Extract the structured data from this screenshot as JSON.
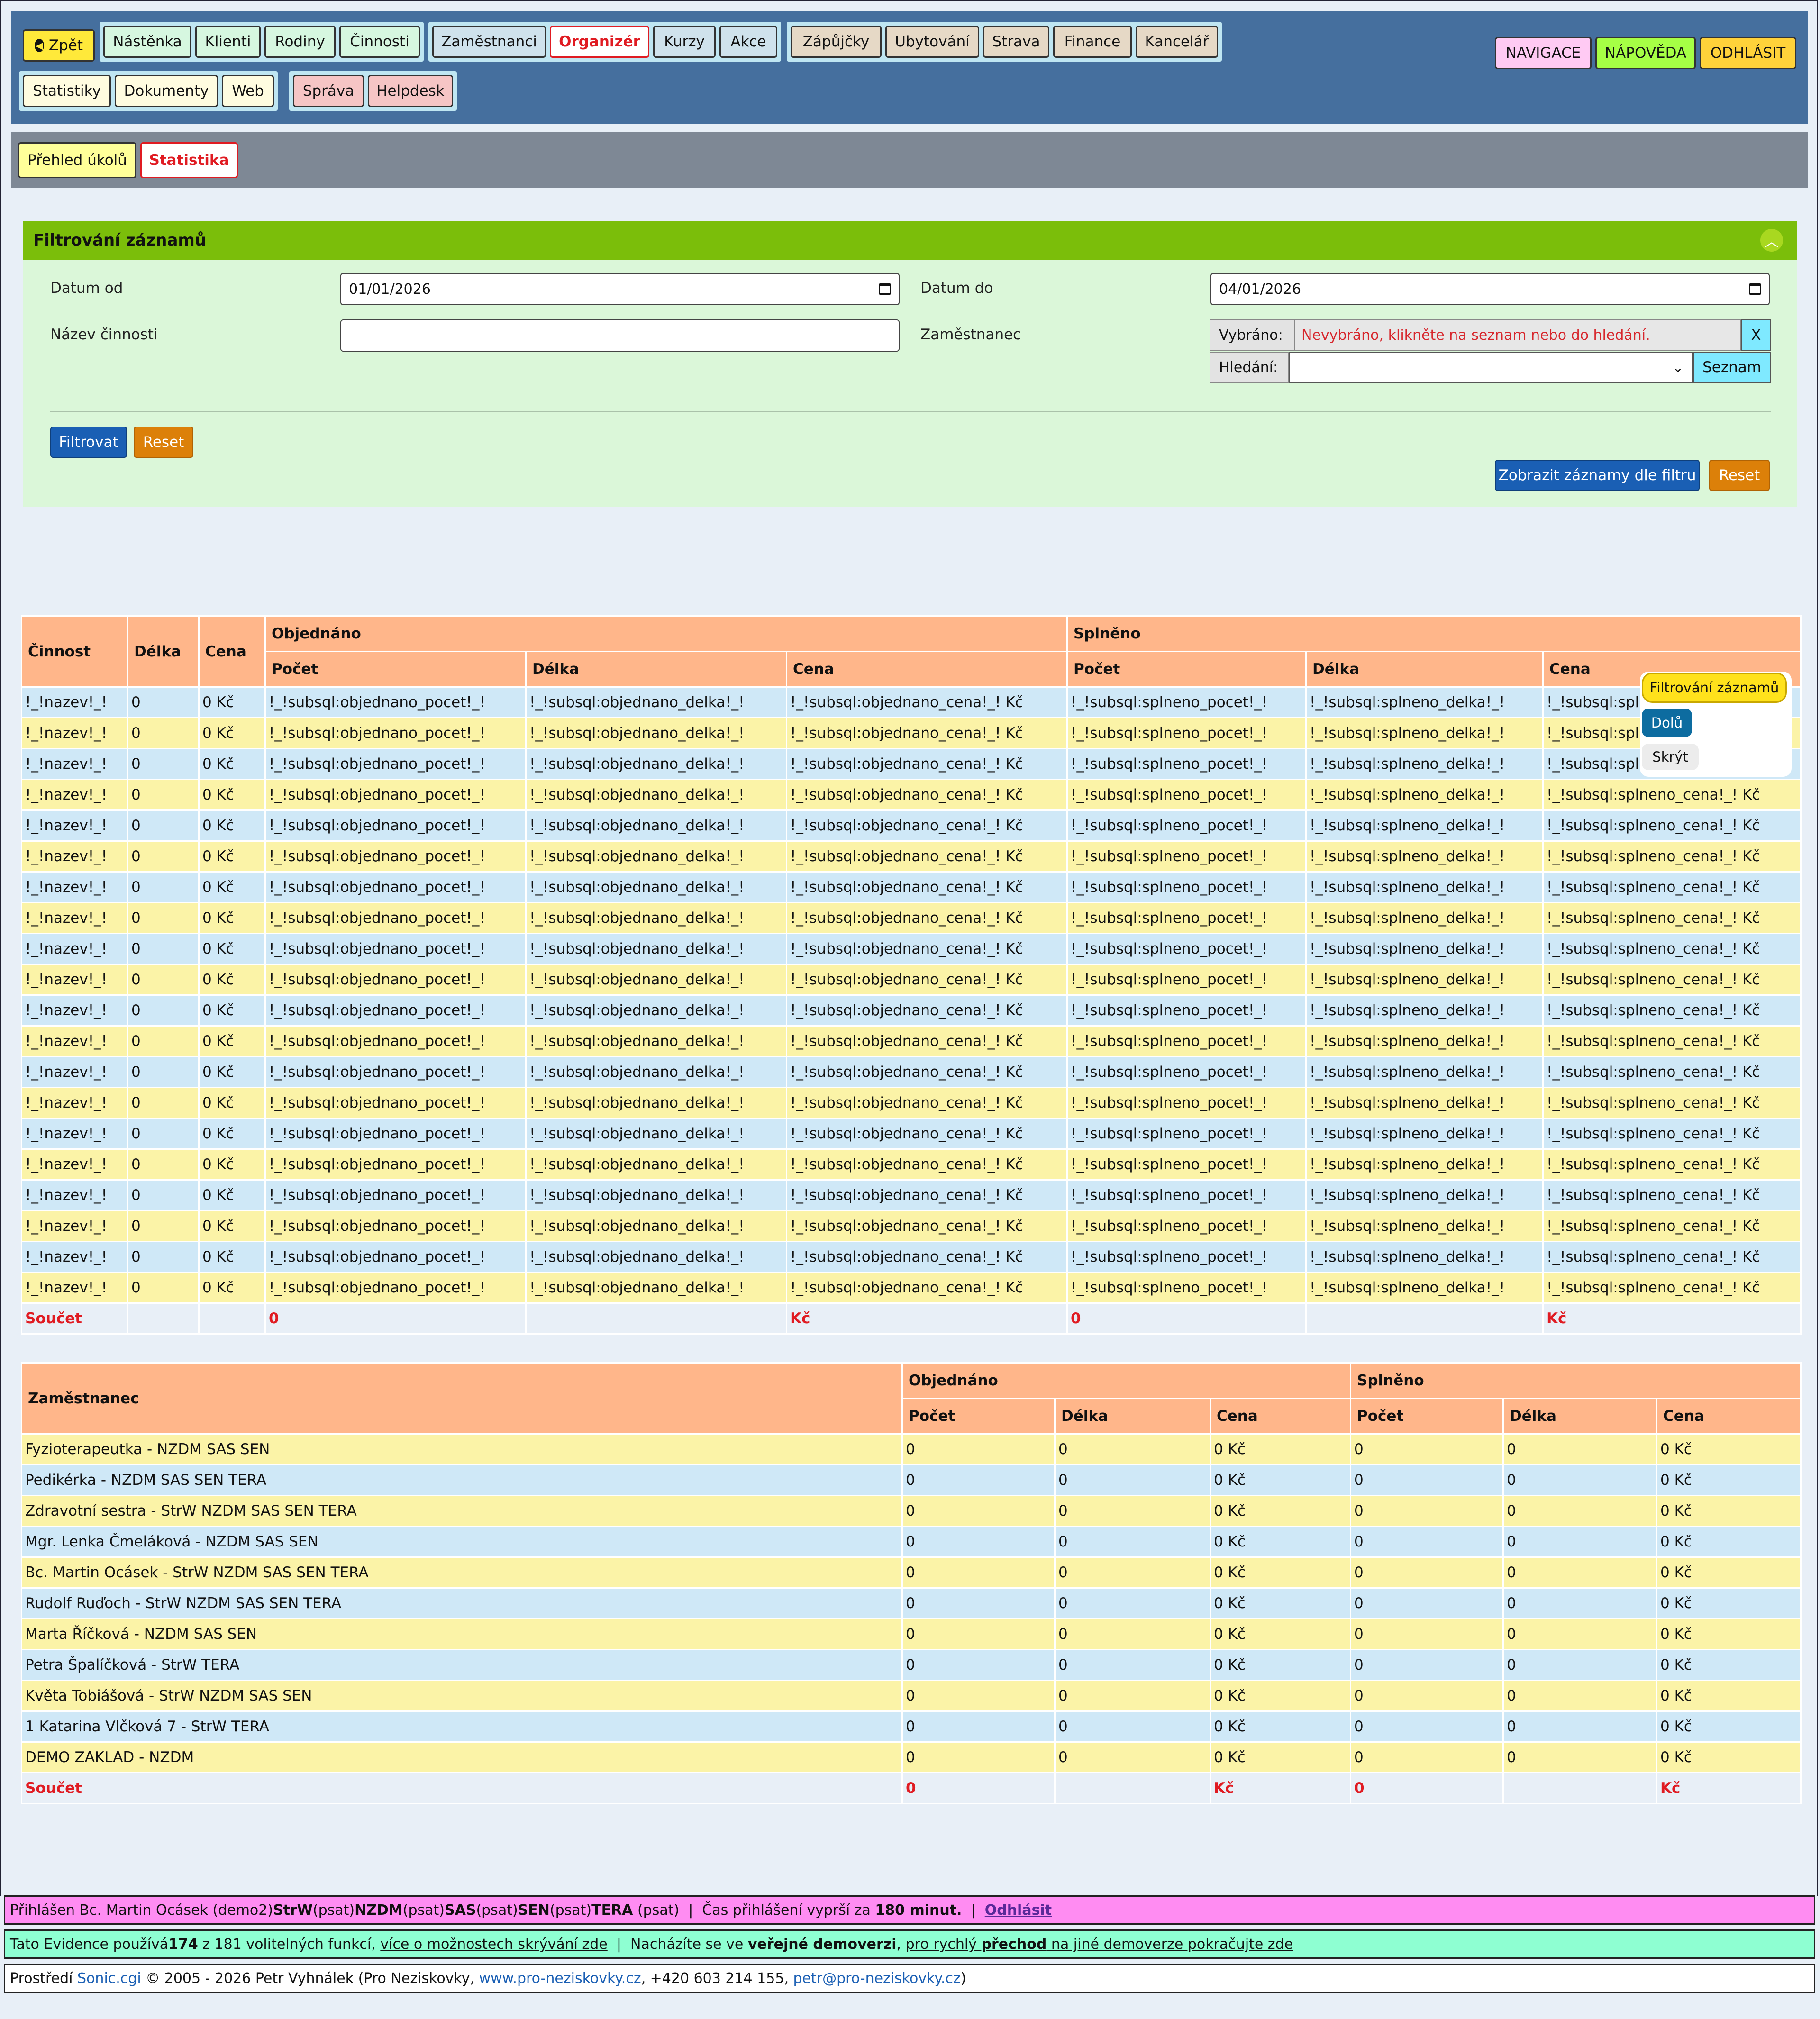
{
  "nav": {
    "back": "Zpět",
    "row1_group1": [
      "Nástěnka",
      "Klienti",
      "Rodiny",
      "Činnosti"
    ],
    "row1_group2": [
      "Zaměstnanci",
      "Organizér",
      "Kurzy",
      "Akce"
    ],
    "row1_group3": [
      "Zápůjčky",
      "Ubytování",
      "Strava",
      "Finance",
      "Kancelář"
    ],
    "row2_group1": [
      "Statistiky",
      "Dokumenty",
      "Web"
    ],
    "row2_group2": [
      "Správa",
      "Helpdesk"
    ],
    "right": [
      "NAVIGACE",
      "NÁPOVĚDA",
      "ODHLÁSIT"
    ]
  },
  "subnav": {
    "tab1": "Přehled úkolů",
    "tab2": "Statistika"
  },
  "filter": {
    "title": "Filtrování záznamů",
    "date_from_label": "Datum od",
    "date_from": "01/01/2026",
    "date_to_label": "Datum do",
    "date_to": "04/01/2026",
    "activity_label": "Název činnosti",
    "activity_value": "",
    "employee_label": "Zaměstnanec",
    "selected_label": "Vybráno:",
    "selected_value": "Nevybráno, klikněte na seznam nebo do hledání.",
    "clear": "X",
    "search_label": "Hledání:",
    "list_button": "Seznam",
    "filter_button": "Filtrovat",
    "reset_button": "Reset",
    "show_button": "Zobrazit záznamy dle filtru",
    "reset2_button": "Reset"
  },
  "table1": {
    "headers": {
      "activity": "Činnost",
      "length": "Délka",
      "price": "Cena",
      "ordered": "Objednáno",
      "done": "Splněno",
      "count": "Počet",
      "length2": "Délka",
      "price2": "Cena"
    },
    "row": [
      "!_!nazev!_!",
      "0",
      "0 Kč",
      "!_!subsql:objednano_pocet!_!",
      "!_!subsql:objednano_delka!_!",
      "!_!subsql:objednano_cena!_! Kč",
      "!_!subsql:splneno_pocet!_!",
      "!_!subsql:splneno_delka!_!",
      "!_!subsql:splneno_cena!_! Kč"
    ],
    "row_count": 20,
    "sum": [
      "Součet",
      "",
      "",
      "0",
      "",
      "Kč",
      "0",
      "",
      "Kč"
    ]
  },
  "table2": {
    "headers": {
      "employee": "Zaměstnanec",
      "ordered": "Objednáno",
      "done": "Splněno",
      "count": "Počet",
      "length": "Délka",
      "price": "Cena"
    },
    "rows": [
      [
        "Fyzioterapeutka - NZDM SAS SEN",
        "0",
        "0",
        "0 Kč",
        "0",
        "0",
        "0 Kč"
      ],
      [
        "Pedikérka - NZDM SAS SEN TERA",
        "0",
        "0",
        "0 Kč",
        "0",
        "0",
        "0 Kč"
      ],
      [
        "Zdravotní sestra - StrW NZDM SAS SEN TERA",
        "0",
        "0",
        "0 Kč",
        "0",
        "0",
        "0 Kč"
      ],
      [
        "Mgr. Lenka Čmeláková - NZDM SAS SEN",
        "0",
        "0",
        "0 Kč",
        "0",
        "0",
        "0 Kč"
      ],
      [
        "Bc. Martin Ocásek - StrW NZDM SAS SEN TERA",
        "0",
        "0",
        "0 Kč",
        "0",
        "0",
        "0 Kč"
      ],
      [
        "Rudolf Ruďoch - StrW NZDM SAS SEN TERA",
        "0",
        "0",
        "0 Kč",
        "0",
        "0",
        "0 Kč"
      ],
      [
        "Marta Říčková - NZDM SAS SEN",
        "0",
        "0",
        "0 Kč",
        "0",
        "0",
        "0 Kč"
      ],
      [
        "Petra Špalíčková - StrW TERA",
        "0",
        "0",
        "0 Kč",
        "0",
        "0",
        "0 Kč"
      ],
      [
        "Květa Tobiášová - StrW NZDM SAS SEN",
        "0",
        "0",
        "0 Kč",
        "0",
        "0",
        "0 Kč"
      ],
      [
        "1 Katarina Vlčková 7 - StrW TERA",
        "0",
        "0",
        "0 Kč",
        "0",
        "0",
        "0 Kč"
      ],
      [
        "DEMO ZAKLAD - NZDM",
        "0",
        "0",
        "0 Kč",
        "0",
        "0",
        "0 Kč"
      ]
    ],
    "sum": [
      "Součet",
      "0",
      "",
      "Kč",
      "0",
      "",
      "Kč"
    ]
  },
  "float_nav": {
    "filter": "Filtrování záznamů",
    "down": "Dolů",
    "hide": "Skrýt"
  },
  "footer": {
    "login": {
      "p1": "Přihlášen Bc. Martin Ocásek (demo2) ",
      "b1": "StrW",
      "p2": " (psat) ",
      "b2": "NZDM",
      "p3": " (psat) ",
      "b3": "SAS",
      "p4": " (psat) ",
      "b4": "SEN",
      "p5": " (psat) ",
      "b5": "TERA",
      "p6": " (psat)  |  Čas přihlášení vyprší za ",
      "b6": "180 minut.",
      "p7": "  |  ",
      "logout": "Odhlásit"
    },
    "info": {
      "p1": "Tato Evidence používá ",
      "b1": "174",
      "p2": " z 181 volitelných funkcí, ",
      "l1": "více o možnostech skrývání zde",
      "p3": "  |  Nacházíte se ve ",
      "b2": "veřejné demoverzi",
      "p4": ", ",
      "l2a": "pro rychlý ",
      "l2b": "přechod",
      "l2c": " na jiné demoverze pokračujte zde"
    },
    "credits": {
      "p1": "Prostředí ",
      "l1": "Sonic.cgi",
      "p2": " © 2005 - 2026 Petr Vyhnálek (Pro Neziskovky, ",
      "l2": "www.pro-neziskovky.cz",
      "p3": ", +420 603 214 155, ",
      "l3": "petr@pro-neziskovky.cz",
      "p4": ")"
    }
  },
  "colors": {
    "nav_bg": "#456f9e",
    "filter_head": "#7bbe0a",
    "table_head": "#ffb68a",
    "row_blue": "#cfe8f7",
    "row_yellow": "#fbf3a7",
    "accent_red": "#e01b22"
  },
  "icons": {
    "back": "circle-arrow-left-icon",
    "collapse": "chevron-up-icon",
    "calendar": "calendar-icon",
    "dropdown": "chevron-down-icon"
  }
}
